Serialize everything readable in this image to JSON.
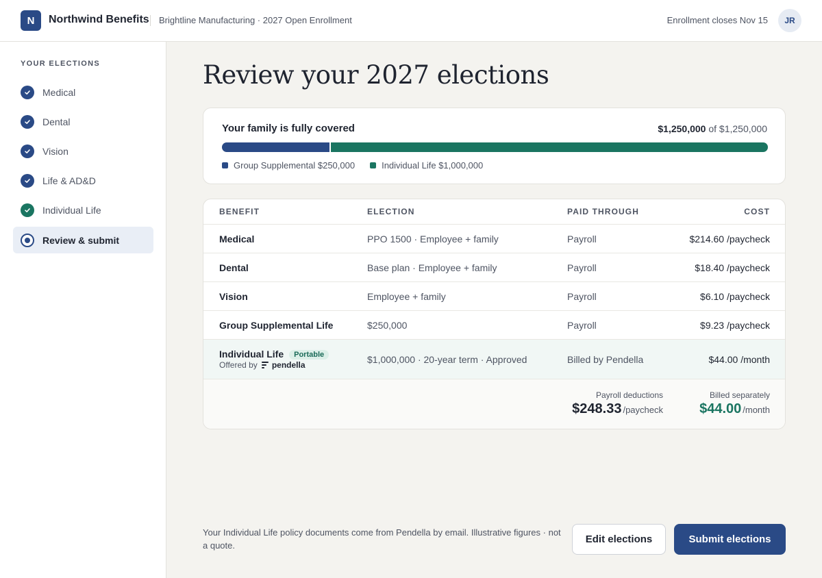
{
  "header": {
    "logo_letter": "N",
    "brand": "Northwind Benefits",
    "context": "Brightline Manufacturing · 2027 Open Enrollment",
    "deadline": "Enrollment closes Nov 15",
    "avatar_initials": "JR"
  },
  "sidebar": {
    "heading": "YOUR ELECTIONS",
    "items": [
      {
        "label": "Medical",
        "status": "complete"
      },
      {
        "label": "Dental",
        "status": "complete"
      },
      {
        "label": "Vision",
        "status": "complete"
      },
      {
        "label": "Life & AD&D",
        "status": "complete"
      },
      {
        "label": "Individual Life",
        "status": "complete"
      },
      {
        "label": "Review & submit",
        "status": "current"
      }
    ]
  },
  "main": {
    "title": "Review your 2027 elections",
    "coverage": {
      "title": "Your family is fully covered",
      "amount": "$1,250,000",
      "of_text": "of $1,250,000",
      "segments": [
        {
          "label": "Group Supplemental $250,000",
          "value": 250000,
          "color": "#2a4a86"
        },
        {
          "label": "Individual Life $1,000,000",
          "value": 1000000,
          "color": "#1a7561"
        }
      ],
      "total": 1250000
    },
    "table": {
      "columns": [
        "BENEFIT",
        "ELECTION",
        "PAID THROUGH",
        "COST"
      ],
      "rows": [
        {
          "benefit": "Medical",
          "election": "PPO 1500 · Employee + family",
          "paid": "Payroll",
          "cost": "$214.60 /paycheck"
        },
        {
          "benefit": "Dental",
          "election": "Base plan · Employee + family",
          "paid": "Payroll",
          "cost": "$18.40 /paycheck"
        },
        {
          "benefit": "Vision",
          "election": "Employee + family",
          "paid": "Payroll",
          "cost": "$6.10 /paycheck"
        },
        {
          "benefit": "Group Supplemental Life",
          "election": "$250,000",
          "paid": "Payroll",
          "cost": "$9.23 /paycheck"
        },
        {
          "benefit": "Individual Life",
          "badge": "Portable",
          "offered_prefix": "Offered by",
          "offered_by": "pendella",
          "election": "$1,000,000 · 20-year term · Approved",
          "paid": "Billed by Pendella",
          "cost": "$44.00 /month"
        }
      ],
      "totals": {
        "payroll_label": "Payroll deductions",
        "payroll_value": "$248.33",
        "payroll_unit": "/paycheck",
        "separate_label": "Billed separately",
        "separate_value": "$44.00",
        "separate_unit": "/month"
      }
    },
    "footnote": "Your Individual Life policy documents come from Pendella by email. Illustrative figures · not a quote.",
    "buttons": {
      "edit": "Edit elections",
      "submit": "Submit elections"
    }
  },
  "colors": {
    "accent": "#2a4a86",
    "teal": "#1a7561"
  }
}
